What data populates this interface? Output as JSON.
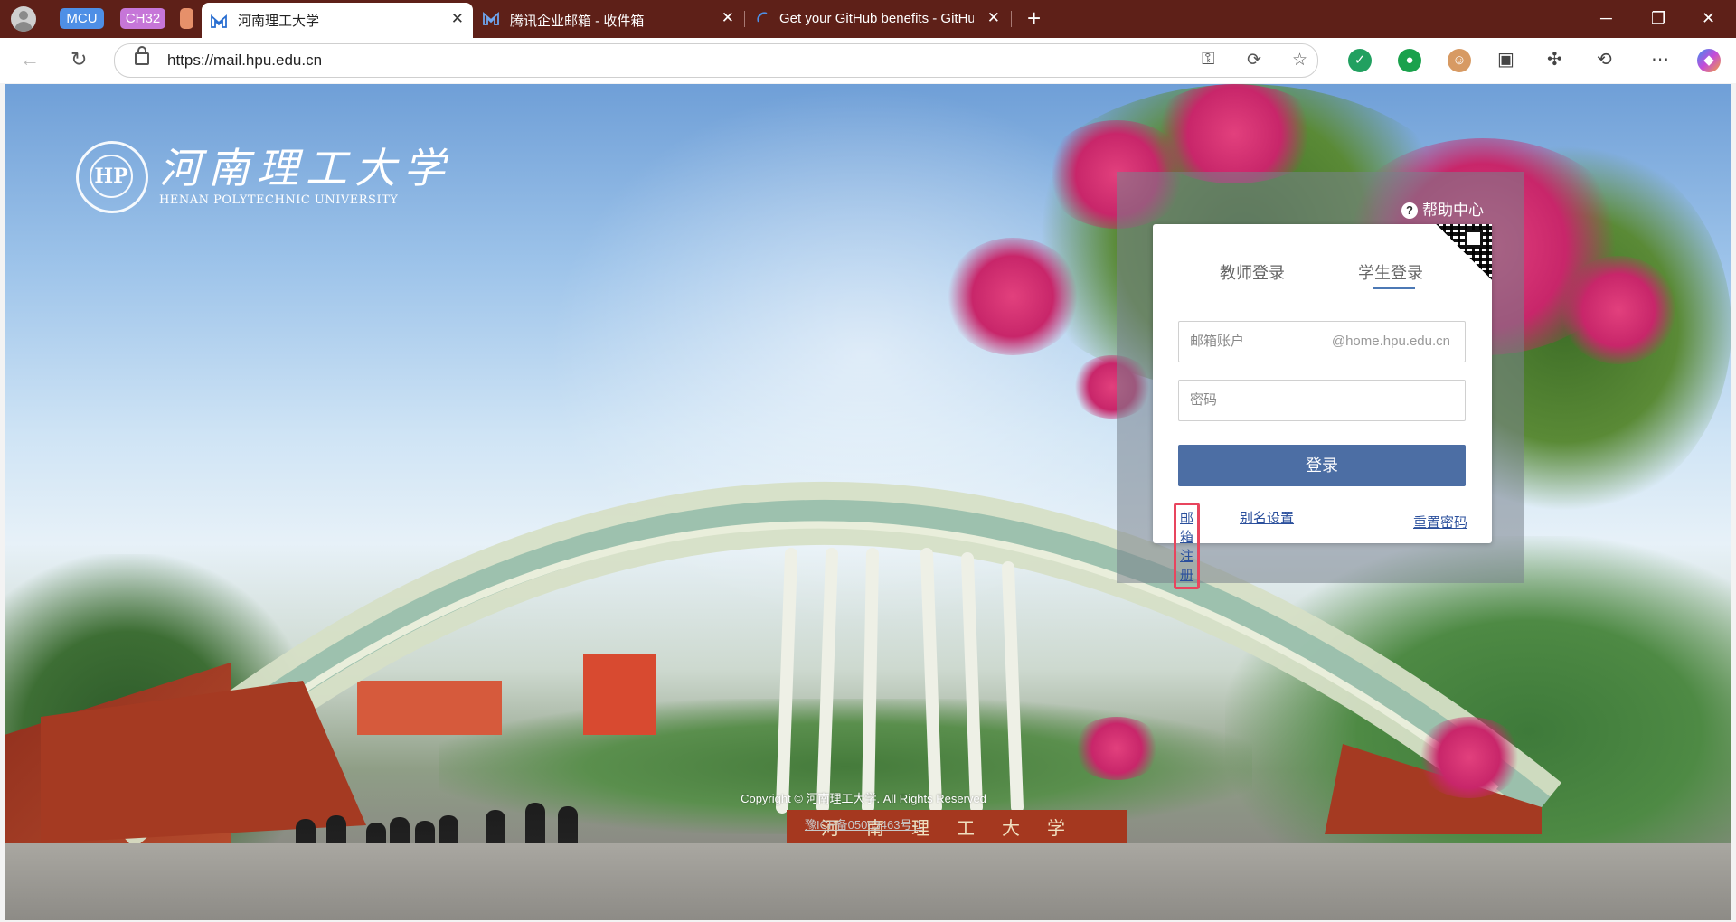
{
  "browser": {
    "tab_groups": [
      {
        "label": "MCU",
        "color": "#4e8fe6"
      },
      {
        "label": "CH32",
        "color": "#c676d8"
      },
      {
        "label": "",
        "color": "#e6906a"
      }
    ],
    "tabs": [
      {
        "title": "河南理工大学",
        "active": true,
        "icon": "tencent-exmail-icon"
      },
      {
        "title": "腾讯企业邮箱 - 收件箱",
        "active": false,
        "icon": "tencent-exmail-icon"
      },
      {
        "title": "Get your GitHub benefits - GitHub",
        "active": false,
        "icon": "loading-icon"
      }
    ],
    "url": "https://mail.hpu.edu.cn",
    "theme_color": "#5e2018"
  },
  "logo": {
    "emblem": "HP",
    "name_cn": "河南理工大学",
    "name_en": "HENAN POLYTECHNIC UNIVERSITY"
  },
  "login": {
    "help_label": "帮助中心",
    "tabs": [
      "教师登录",
      "学生登录"
    ],
    "selected_tab": "学生登录",
    "account_placeholder": "邮箱账户",
    "account_suffix": "@home.hpu.edu.cn",
    "password_placeholder": "密码",
    "submit_label": "登录",
    "register_link": "邮箱注册",
    "alias_link": "别名设置",
    "reset_link": "重置密码",
    "accent": "#4c6ea4",
    "highlight_color": "#e8455e"
  },
  "scene": {
    "gate_inscription": "河南理工大学"
  },
  "footer": {
    "copyright": "Copyright ©  河南理工大学. All Rights Reserved",
    "icp": "豫ICP备05003463号-1"
  }
}
